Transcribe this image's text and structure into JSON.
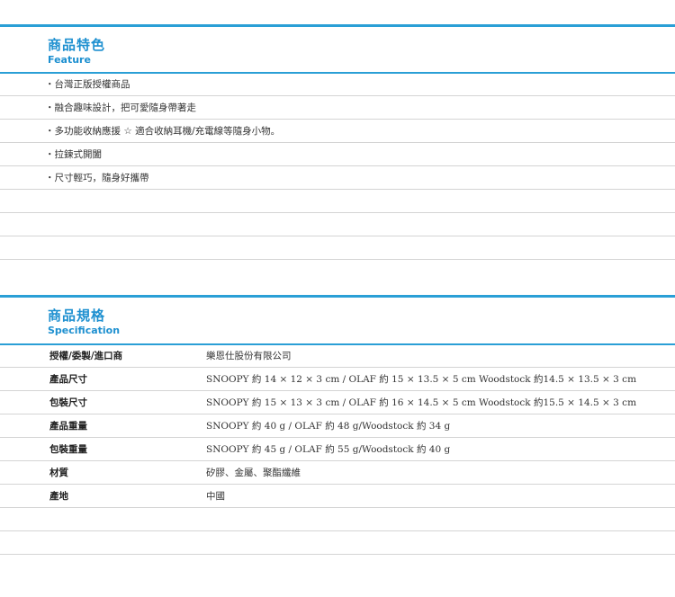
{
  "feature": {
    "title": "商品特色",
    "subtitle": "Feature",
    "items": [
      "・台灣正版授權商品",
      "・融合趣味設計，把可愛隨身帶著走",
      "・多功能收納應援 ☆ 適合收納耳機/充電線等隨身小物。",
      "・拉鍊式開闔",
      "・尺寸輕巧，隨身好攜帶",
      "",
      "",
      ""
    ]
  },
  "spec": {
    "title": "商品規格",
    "subtitle": "Specification",
    "rows": [
      {
        "label": "授權/委製/進口商",
        "value": "樂恩仕股份有限公司"
      },
      {
        "label": "產品尺寸",
        "value": "SNOOPY 約 14 × 12 × 3 cm / OLAF 約 15 × 13.5 × 5 cm Woodstock 約14.5 × 13.5 × 3 cm"
      },
      {
        "label": "包裝尺寸",
        "value": "SNOOPY 約 15 × 13 × 3 cm / OLAF 約 16 × 14.5 × 5 cm Woodstock 約15.5 × 14.5 × 3 cm"
      },
      {
        "label": "產品重量",
        "value": "SNOOPY 約 40 g / OLAF 約 48 g/Woodstock 約 34 g"
      },
      {
        "label": "包裝重量",
        "value": "SNOOPY 約 45 g / OLAF 約 55 g/Woodstock 約 40 g"
      },
      {
        "label": "材質",
        "value": "矽膠、金屬、聚酯纖維"
      },
      {
        "label": "產地",
        "value": "中國"
      },
      {
        "label": "",
        "value": ""
      },
      {
        "label": "",
        "value": ""
      }
    ]
  }
}
